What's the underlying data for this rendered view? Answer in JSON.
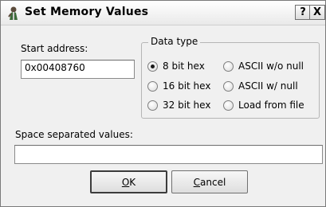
{
  "window": {
    "title": "Set Memory Values",
    "help_label": "?",
    "close_label": "X"
  },
  "start_address": {
    "label": "Start address:",
    "value": "0x00408760"
  },
  "data_type": {
    "legend": "Data type",
    "options": [
      {
        "label": "8 bit hex",
        "checked": true
      },
      {
        "label": "ASCII w/o null",
        "checked": false
      },
      {
        "label": "16 bit hex",
        "checked": false
      },
      {
        "label": "ASCII w/ null",
        "checked": false
      },
      {
        "label": "32 bit hex",
        "checked": false
      },
      {
        "label": "Load from file",
        "checked": false
      }
    ]
  },
  "values": {
    "label": "Space separated values:",
    "value": ""
  },
  "buttons": {
    "ok_mnemonic": "O",
    "ok_rest": "K",
    "cancel_mnemonic": "C",
    "cancel_rest": "ancel"
  }
}
